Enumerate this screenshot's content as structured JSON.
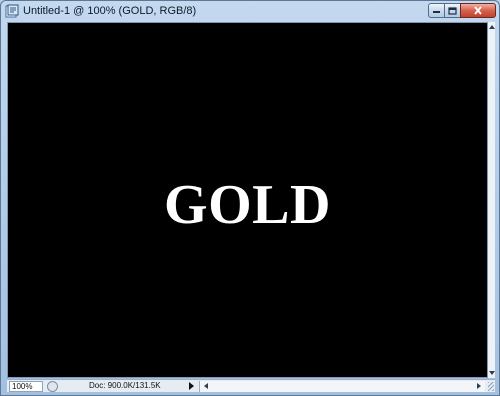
{
  "window": {
    "title": "Untitled-1 @ 100% (GOLD, RGB/8)",
    "app_icon": "photoshop-document-icon",
    "controls": {
      "minimize_icon": "minimize-icon",
      "maximize_icon": "maximize-icon",
      "close_icon": "close-icon"
    }
  },
  "canvas": {
    "text": "GOLD",
    "background": "#000000",
    "text_color": "#ffffff"
  },
  "statusbar": {
    "zoom": "100%",
    "doc_info": "Doc: 900.0K/131.5K",
    "menu_arrow_icon": "triangle-right-icon"
  },
  "colors": {
    "frame": "#b4cde6",
    "close_button": "#c94a34"
  }
}
